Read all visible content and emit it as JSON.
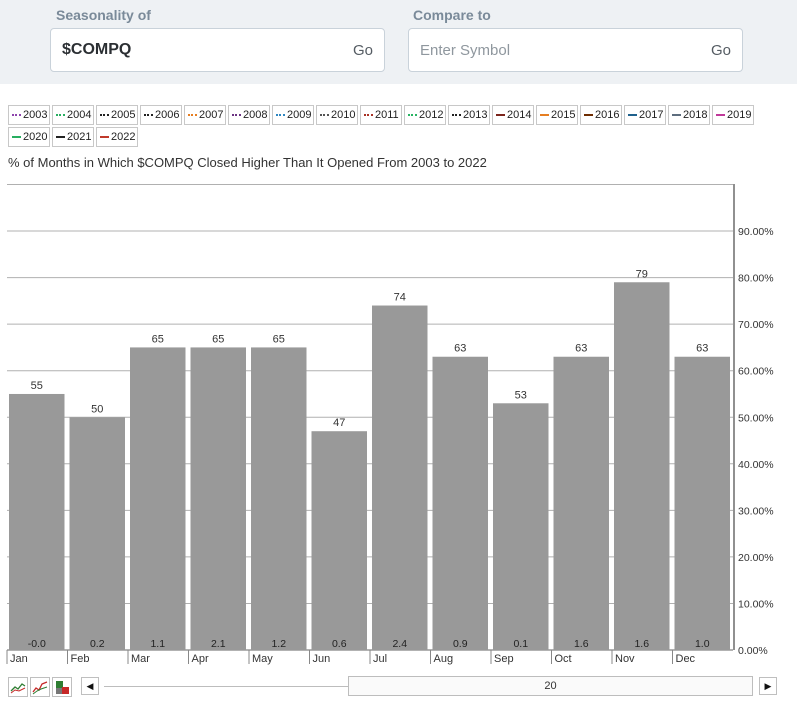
{
  "seasonality": {
    "label": "Seasonality of",
    "value": "$COMPQ",
    "go": "Go"
  },
  "compare": {
    "label": "Compare to",
    "placeholder": "Enter Symbol",
    "go": "Go"
  },
  "legend": [
    {
      "year": "2003",
      "color": "#8e44ad",
      "style": "dotted"
    },
    {
      "year": "2004",
      "color": "#27ae60",
      "style": "dotted"
    },
    {
      "year": "2005",
      "color": "#222222",
      "style": "dotted"
    },
    {
      "year": "2006",
      "color": "#222222",
      "style": "dotted"
    },
    {
      "year": "2007",
      "color": "#e67e22",
      "style": "dotted"
    },
    {
      "year": "2008",
      "color": "#6c3483",
      "style": "dotted"
    },
    {
      "year": "2009",
      "color": "#2e86c1",
      "style": "dotted"
    },
    {
      "year": "2010",
      "color": "#555555",
      "style": "dotted"
    },
    {
      "year": "2011",
      "color": "#a93226",
      "style": "dotted"
    },
    {
      "year": "2012",
      "color": "#28b463",
      "style": "dotted"
    },
    {
      "year": "2013",
      "color": "#222222",
      "style": "dotted"
    },
    {
      "year": "2014",
      "color": "#7b241c",
      "style": "solid"
    },
    {
      "year": "2015",
      "color": "#e67e22",
      "style": "solid"
    },
    {
      "year": "2016",
      "color": "#6e2c00",
      "style": "solid"
    },
    {
      "year": "2017",
      "color": "#1f618d",
      "style": "solid"
    },
    {
      "year": "2018",
      "color": "#5d6d7e",
      "style": "solid"
    },
    {
      "year": "2019",
      "color": "#c0399a",
      "style": "solid"
    },
    {
      "year": "2020",
      "color": "#27ae60",
      "style": "solid"
    },
    {
      "year": "2021",
      "color": "#222222",
      "style": "solid"
    },
    {
      "year": "2022",
      "color": "#c0392b",
      "style": "solid"
    }
  ],
  "chart_title": "% of Months in Which $COMPQ Closed Higher Than It Opened From 2003 to 2022",
  "colors": {
    "bar": "#999999",
    "grid": "#b0b0b0"
  },
  "chart_data": {
    "type": "bar",
    "title": "% of Months in Which $COMPQ Closed Higher Than It Opened From 2003 to 2022",
    "categories": [
      "Jan",
      "Feb",
      "Mar",
      "Apr",
      "May",
      "Jun",
      "Jul",
      "Aug",
      "Sep",
      "Oct",
      "Nov",
      "Dec"
    ],
    "values": [
      55,
      50,
      65,
      65,
      65,
      47,
      74,
      63,
      53,
      63,
      79,
      63
    ],
    "value_labels": [
      "55",
      "50",
      "65",
      "65",
      "65",
      "47",
      "74",
      "63",
      "53",
      "63",
      "79",
      "63"
    ],
    "bottom_labels": [
      "-0.0",
      "0.2",
      "1.1",
      "2.1",
      "1.2",
      "0.6",
      "2.4",
      "0.9",
      "0.1",
      "1.6",
      "1.6",
      "1.0"
    ],
    "y_ticks": [
      "0.00%",
      "10.00%",
      "20.00%",
      "30.00%",
      "40.00%",
      "50.00%",
      "60.00%",
      "70.00%",
      "80.00%",
      "90.00%"
    ],
    "ylim": [
      0,
      100
    ],
    "grid": true
  },
  "slider": {
    "value": "20"
  }
}
